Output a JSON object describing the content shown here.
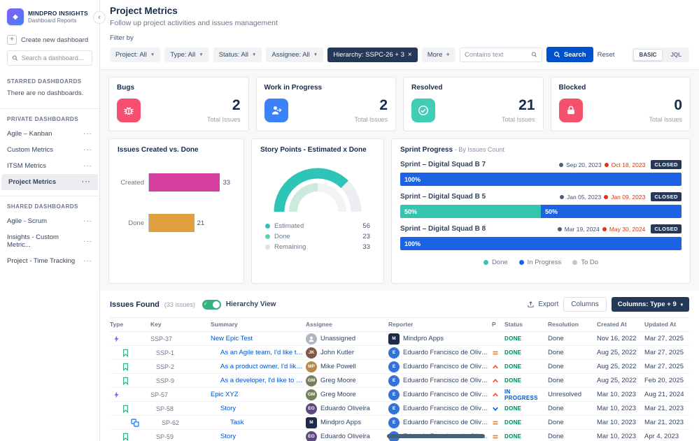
{
  "sidebar": {
    "logo_title": "MINDPRO INSIGHTS",
    "logo_subtitle": "Dashboard Reports",
    "create_label": "Create new dashboard",
    "search_placeholder": "Search a dashboard...",
    "sections": [
      {
        "title": "STARRED DASHBOARDS",
        "empty": "There are no dashboards.",
        "items": []
      },
      {
        "title": "PRIVATE DASHBOARDS",
        "items": [
          {
            "label": "Agile – Kanban"
          },
          {
            "label": "Custom Metrics"
          },
          {
            "label": "ITSM Metrics"
          },
          {
            "label": "Project Metrics",
            "selected": true
          }
        ]
      },
      {
        "title": "SHARED DASHBOARDS",
        "items": [
          {
            "label": "Agile - Scrum"
          },
          {
            "label": "Insights - Custom Metric..."
          },
          {
            "label": "Project - Time Tracking"
          }
        ]
      }
    ]
  },
  "header": {
    "title": "Project Metrics",
    "subtitle": "Follow up project activities and issues management"
  },
  "filters": {
    "label": "Filter by",
    "dropdowns": [
      "Project: All",
      "Type: All",
      "Status: All",
      "Assignee: All"
    ],
    "hierarchy_chip": "Hierarchy: SSPC-26 + 3",
    "more_label": "More",
    "contains_placeholder": "Contains text",
    "search_label": "Search",
    "reset_label": "Reset",
    "mode_basic": "BASIC",
    "mode_jql": "JQL"
  },
  "stats": [
    {
      "title": "Bugs",
      "value": "2",
      "caption": "Total Issues",
      "icon": "bug",
      "color": "#f64e6e"
    },
    {
      "title": "Work in Progress",
      "value": "2",
      "caption": "Total Issues",
      "icon": "progress",
      "color": "#3b82f6"
    },
    {
      "title": "Resolved",
      "value": "21",
      "caption": "Total Issues",
      "icon": "resolved",
      "color": "#3fcdb5"
    },
    {
      "title": "Blocked",
      "value": "0",
      "caption": "Total Issues",
      "icon": "blocked",
      "color": "#f4516c"
    }
  ],
  "charts": {
    "created_done": {
      "type": "bar",
      "title": "Issues Created vs. Done",
      "categories": [
        "Created",
        "Done"
      ],
      "values": [
        33,
        21
      ],
      "colors": [
        "#d63f9e",
        "#dfa140"
      ],
      "max": 40
    },
    "story_points": {
      "type": "gauge",
      "title": "Story Points - Estimated x Done",
      "legend": [
        {
          "label": "Estimated",
          "value": 56,
          "color": "#2ec4b6"
        },
        {
          "label": "Done",
          "value": 23,
          "color": "#57d9a3"
        },
        {
          "label": "Remaining",
          "value": 33,
          "color": "#dfe1e6"
        }
      ]
    },
    "sprint_progress": {
      "type": "stacked-bar-list",
      "title": "Sprint Progress",
      "subtitle": "- By Issues Count",
      "sprints": [
        {
          "name": "Sprint – Digital Squad B 7",
          "start": "Sep 20, 2023",
          "end": "Oct 18, 2023",
          "badge": "CLOSED",
          "segments": [
            {
              "label": "100%",
              "pct": 100,
              "type": "inprogress"
            }
          ]
        },
        {
          "name": "Sprint – Digital Squad B 5",
          "start": "Jan 05, 2023",
          "end": "Jan 09, 2023",
          "badge": "CLOSED",
          "segments": [
            {
              "label": "50%",
              "pct": 50,
              "type": "done"
            },
            {
              "label": "50%",
              "pct": 50,
              "type": "inprogress"
            }
          ]
        },
        {
          "name": "Sprint – Digital Squad B 8",
          "start": "Mar 19, 2024",
          "end": "May 30, 2024",
          "badge": "CLOSED",
          "segments": [
            {
              "label": "100%",
              "pct": 100,
              "type": "inprogress"
            }
          ]
        }
      ],
      "legend": [
        {
          "label": "Done",
          "color": "#35c4ae"
        },
        {
          "label": "In Progress",
          "color": "#1b63e4"
        },
        {
          "label": "To Do",
          "color": "#c1c7d0"
        }
      ]
    }
  },
  "issues": {
    "title": "Issues Found",
    "count_label": "(33 issues)",
    "toggle_label": "Hierarchy View",
    "export_label": "Export",
    "columns_label": "Columns",
    "columns_dropdown": "Columns: Type + 9",
    "columns": [
      "Type",
      "Key",
      "Summary",
      "Assignee",
      "Reporter",
      "P",
      "Status",
      "Resolution",
      "Created At",
      "Updated At"
    ],
    "rows": [
      {
        "type": "epic",
        "indent": 0,
        "key": "SSP-37",
        "summary": "New Epic Test",
        "assignee": {
          "name": "Unassigned",
          "kind": "silhouette",
          "bg": "#aeb6c2"
        },
        "reporter": {
          "name": "Mindpro Apps",
          "kind": "logo",
          "initials": "M",
          "bg": "#1c2b4a"
        },
        "priority": "",
        "status": "DONE",
        "resolution": "Done",
        "created": "Nov 16, 2022",
        "updated": "Mar 27, 2025"
      },
      {
        "type": "story",
        "indent": 1,
        "key": "SSP-1",
        "summary": "As an Agile team, I'd like to l...",
        "assignee": {
          "name": "John Kutler",
          "kind": "initials",
          "initials": "JK",
          "bg": "#7d5a44"
        },
        "reporter": {
          "name": "Eduardo Francisco de Oliveira",
          "kind": "initials",
          "initials": "E",
          "bg": "#3573d9"
        },
        "priority": "medium",
        "status": "DONE",
        "resolution": "Done",
        "created": "Aug 25, 2022",
        "updated": "Mar 27, 2025"
      },
      {
        "type": "story",
        "indent": 1,
        "key": "SSP-2",
        "summary": "As a product owner, I'd like t...",
        "assignee": {
          "name": "Mike Powell",
          "kind": "initials",
          "initials": "MP",
          "bg": "#b7894a"
        },
        "reporter": {
          "name": "Eduardo Francisco de Oliveira",
          "kind": "initials",
          "initials": "E",
          "bg": "#3573d9"
        },
        "priority": "high",
        "status": "DONE",
        "resolution": "Done",
        "created": "Aug 25, 2022",
        "updated": "Mar 27, 2025"
      },
      {
        "type": "story",
        "indent": 1,
        "key": "SSP-9",
        "summary": "As a developer, I'd like to up...",
        "assignee": {
          "name": "Greg Moore",
          "kind": "initials",
          "initials": "GM",
          "bg": "#75815c"
        },
        "reporter": {
          "name": "Eduardo Francisco de Oliveira",
          "kind": "initials",
          "initials": "E",
          "bg": "#3573d9"
        },
        "priority": "high",
        "status": "DONE",
        "resolution": "Done",
        "created": "Aug 25, 2022",
        "updated": "Feb 20, 2025"
      },
      {
        "type": "epic",
        "indent": 0,
        "key": "SP-57",
        "summary": "Epic XYZ",
        "assignee": {
          "name": "Greg Moore",
          "kind": "initials",
          "initials": "GM",
          "bg": "#75815c"
        },
        "reporter": {
          "name": "Eduardo Francisco de Oliveira",
          "kind": "initials",
          "initials": "E",
          "bg": "#3573d9"
        },
        "priority": "high",
        "status": "IN PROGRESS",
        "resolution": "Unresolved",
        "created": "Mar 10, 2023",
        "updated": "Aug 21, 2024"
      },
      {
        "type": "story",
        "indent": 1,
        "key": "SP-58",
        "summary": "Story",
        "assignee": {
          "name": "Eduardo Oliveira",
          "kind": "initials",
          "initials": "EO",
          "bg": "#5d4a7e"
        },
        "reporter": {
          "name": "Eduardo Francisco de Oliveira",
          "kind": "initials",
          "initials": "E",
          "bg": "#3573d9"
        },
        "priority": "low",
        "status": "DONE",
        "resolution": "Done",
        "created": "Mar 10, 2023",
        "updated": "Mar 21, 2023"
      },
      {
        "type": "subtask",
        "indent": 2,
        "key": "SP-62",
        "summary": "Task",
        "assignee": {
          "name": "Mindpro Apps",
          "kind": "logo",
          "initials": "M",
          "bg": "#1c2b4a"
        },
        "reporter": {
          "name": "Eduardo Francisco de Oliveira",
          "kind": "initials",
          "initials": "E",
          "bg": "#3573d9"
        },
        "priority": "medium",
        "status": "DONE",
        "resolution": "Done",
        "created": "Mar 10, 2023",
        "updated": "Mar 21, 2023"
      },
      {
        "type": "story",
        "indent": 1,
        "key": "SP-59",
        "summary": "Story",
        "assignee": {
          "name": "Eduardo Oliveira",
          "kind": "initials",
          "initials": "EO",
          "bg": "#5d4a7e"
        },
        "reporter": {
          "name": "Eduardo Francisco de Oliveira",
          "kind": "initials",
          "initials": "E",
          "bg": "#3573d9"
        },
        "priority": "medium",
        "status": "DONE",
        "resolution": "Done",
        "created": "Mar 10, 2023",
        "updated": "Apr 4, 2023"
      }
    ]
  }
}
